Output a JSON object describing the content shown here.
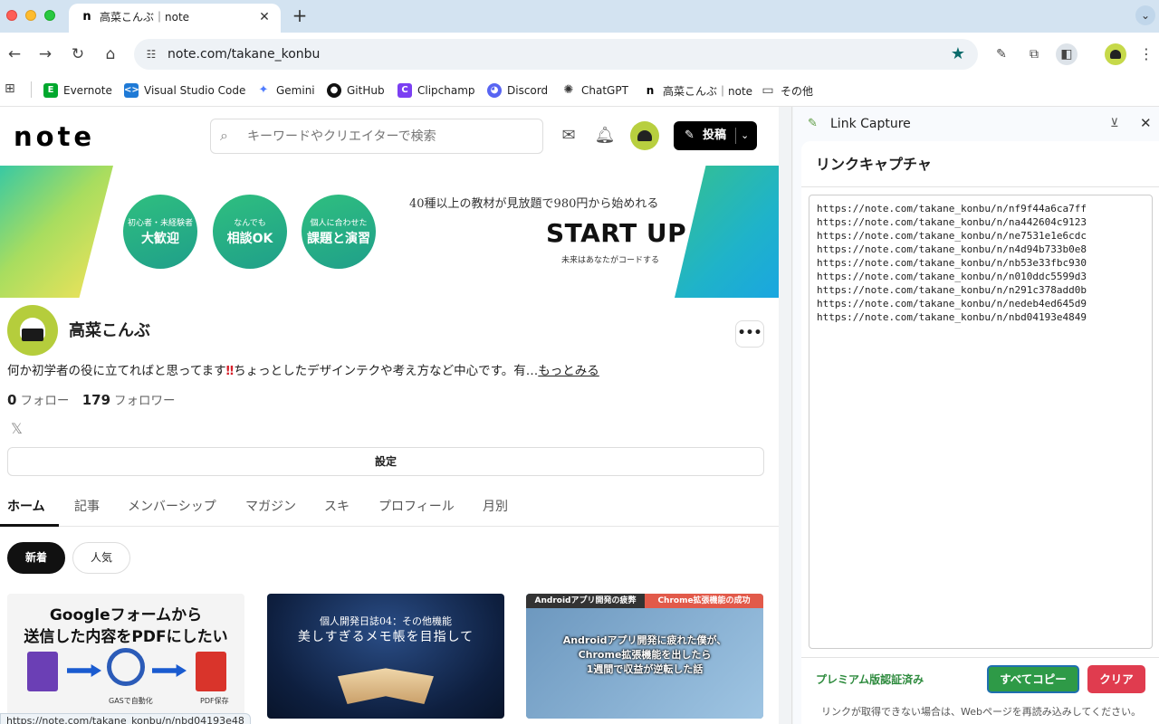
{
  "browser": {
    "tab_favicon": "n",
    "tab_title": "高菜こんぶ｜note",
    "tab_close": "✕",
    "new_tab": "+",
    "url": "note.com/takane_konbu",
    "bookmarks": [
      {
        "label": "Evernote",
        "icon": "evernote-icon",
        "color": "#00a82d",
        "glyph": "E"
      },
      {
        "label": "Visual Studio Code",
        "icon": "vscode-icon",
        "color": "#1f7ad6",
        "glyph": "⟨⟩"
      },
      {
        "label": "Gemini",
        "icon": "gemini-icon",
        "color": "#6c8cff",
        "glyph": "✦"
      },
      {
        "label": "GitHub",
        "icon": "github-icon",
        "color": "#111111",
        "glyph": "◉"
      },
      {
        "label": "Clipchamp",
        "icon": "clipchamp-icon",
        "color": "#7b3ff2",
        "glyph": "C"
      },
      {
        "label": "Discord",
        "icon": "discord-icon",
        "color": "#5865f2",
        "glyph": "◕"
      },
      {
        "label": "ChatGPT",
        "icon": "chatgpt-icon",
        "color": "#333333",
        "glyph": "✺"
      },
      {
        "label": "高菜こんぶ｜note",
        "icon": "note-icon",
        "color": "#ffffff",
        "glyph": "n"
      },
      {
        "label": "その他",
        "icon": "folder-icon",
        "color": "#ffffff",
        "glyph": "▭"
      }
    ]
  },
  "note": {
    "logo": "note",
    "search_placeholder": "キーワードやクリエイターで検索",
    "post_label": "投稿",
    "banner": {
      "circles": [
        {
          "small": "初心者・未経験者",
          "big": "大歓迎"
        },
        {
          "small": "なんでも",
          "big": "相談OK"
        },
        {
          "small": "個人に合わせた",
          "big": "課題と演習"
        }
      ],
      "tagline": "40種以上の教材が見放題で980円から始めれる",
      "title": "START UP",
      "sub": "未来はあなたがコードする"
    },
    "profile": {
      "name": "高菜こんぶ",
      "bio_before": "何か初学者の役に立てればと思ってます",
      "bio_mark": "‼",
      "bio_after": "ちょっとしたデザインテクや考え方など中心です。有…",
      "bio_more": "もっとみる",
      "follow_count": "0",
      "follow_label": "フォロー",
      "follower_count": "179",
      "follower_label": "フォロワー",
      "settings_label": "設定"
    },
    "tabs": [
      "ホーム",
      "記事",
      "メンバーシップ",
      "マガジン",
      "スキ",
      "プロフィール",
      "月別"
    ],
    "chips": {
      "new": "新着",
      "popular": "人気"
    },
    "cards": {
      "card1_title_line1": "Googleフォームから",
      "card1_title_line2": "送信した内容をPDFにしたい",
      "card1_cap_mid": "GASで自動化",
      "card1_cap_right": "PDF保存",
      "card2_line1": "個人開発日誌04：その他機能",
      "card2_line2": "美しすぎるメモ帳を目指して",
      "card3_head_left": "Androidアプリ開発の疲弊",
      "card3_head_right": "Chrome拡張機能の成功",
      "card3_line1": "Androidアプリ開発に疲れた僕が、",
      "card3_line2": "Chrome拡張機能を出したら",
      "card3_line3": "1週間で収益が逆転した話"
    },
    "status_url": "https://note.com/takane_konbu/n/nbd04193e48"
  },
  "side_panel": {
    "title": "Link Capture",
    "heading": "リンクキャプチャ",
    "links": [
      "https://note.com/takane_konbu/n/nf9f44a6ca7ff",
      "https://note.com/takane_konbu/n/na442604c9123",
      "https://note.com/takane_konbu/n/ne7531e1e6cdc",
      "https://note.com/takane_konbu/n/n4d94b733b0e8",
      "https://note.com/takane_konbu/n/nb53e33fbc930",
      "https://note.com/takane_konbu/n/n010ddc5599d3",
      "https://note.com/takane_konbu/n/n291c378add0b",
      "https://note.com/takane_konbu/n/nedeb4ed645d9",
      "https://note.com/takane_konbu/n/nbd04193e4849"
    ],
    "premium_label": "プレミアム版認証済み",
    "copy_all_label": "すべてコピー",
    "clear_label": "クリア",
    "reload_note": "リンクが取得できない場合は、Webページを再読み込みしてください。"
  }
}
